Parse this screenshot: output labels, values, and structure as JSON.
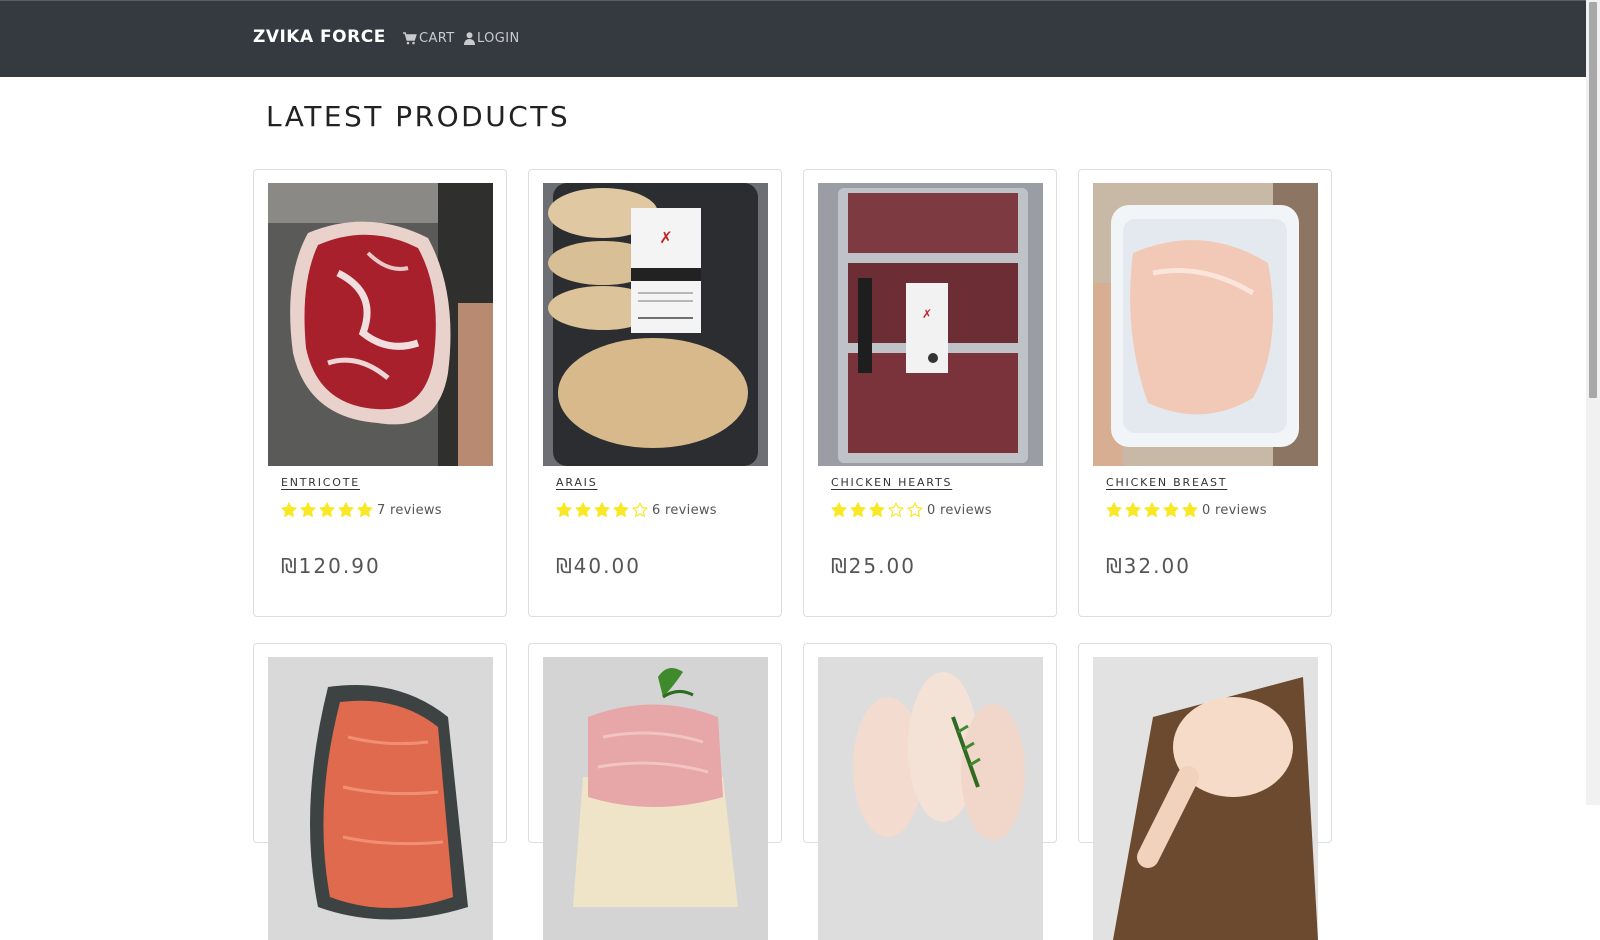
{
  "navbar": {
    "brand": "ZVIKA FORCE",
    "cart_label": "CART",
    "login_label": "LOGIN"
  },
  "page_title": "LATEST PRODUCTS",
  "products": [
    {
      "name": "ENTRICOTE",
      "rating": 5,
      "reviews": "7 reviews",
      "price": "₪120.90",
      "image": "ribeye-steak"
    },
    {
      "name": "ARAIS",
      "rating": 4,
      "reviews": "6 reviews",
      "price": "₪40.00",
      "image": "arais-pitas-pack"
    },
    {
      "name": "CHICKEN HEARTS",
      "rating": 3,
      "reviews": "0 reviews",
      "price": "₪25.00",
      "image": "chicken-hearts-skewers"
    },
    {
      "name": "CHICKEN BREAST",
      "rating": 5,
      "reviews": "0 reviews",
      "price": "₪32.00",
      "image": "chicken-breast-tray"
    },
    {
      "name": "",
      "rating": null,
      "reviews": "",
      "price": "",
      "image": "ground-beef-tray"
    },
    {
      "name": "",
      "rating": null,
      "reviews": "",
      "price": "",
      "image": "ground-meat-herbs"
    },
    {
      "name": "",
      "rating": null,
      "reviews": "",
      "price": "",
      "image": "chicken-drumsticks"
    },
    {
      "name": "",
      "rating": null,
      "reviews": "",
      "price": "",
      "image": "chicken-leg-board"
    }
  ],
  "colors": {
    "navbar_bg": "#343a40",
    "star": "#f8e825",
    "text": "#333333"
  }
}
